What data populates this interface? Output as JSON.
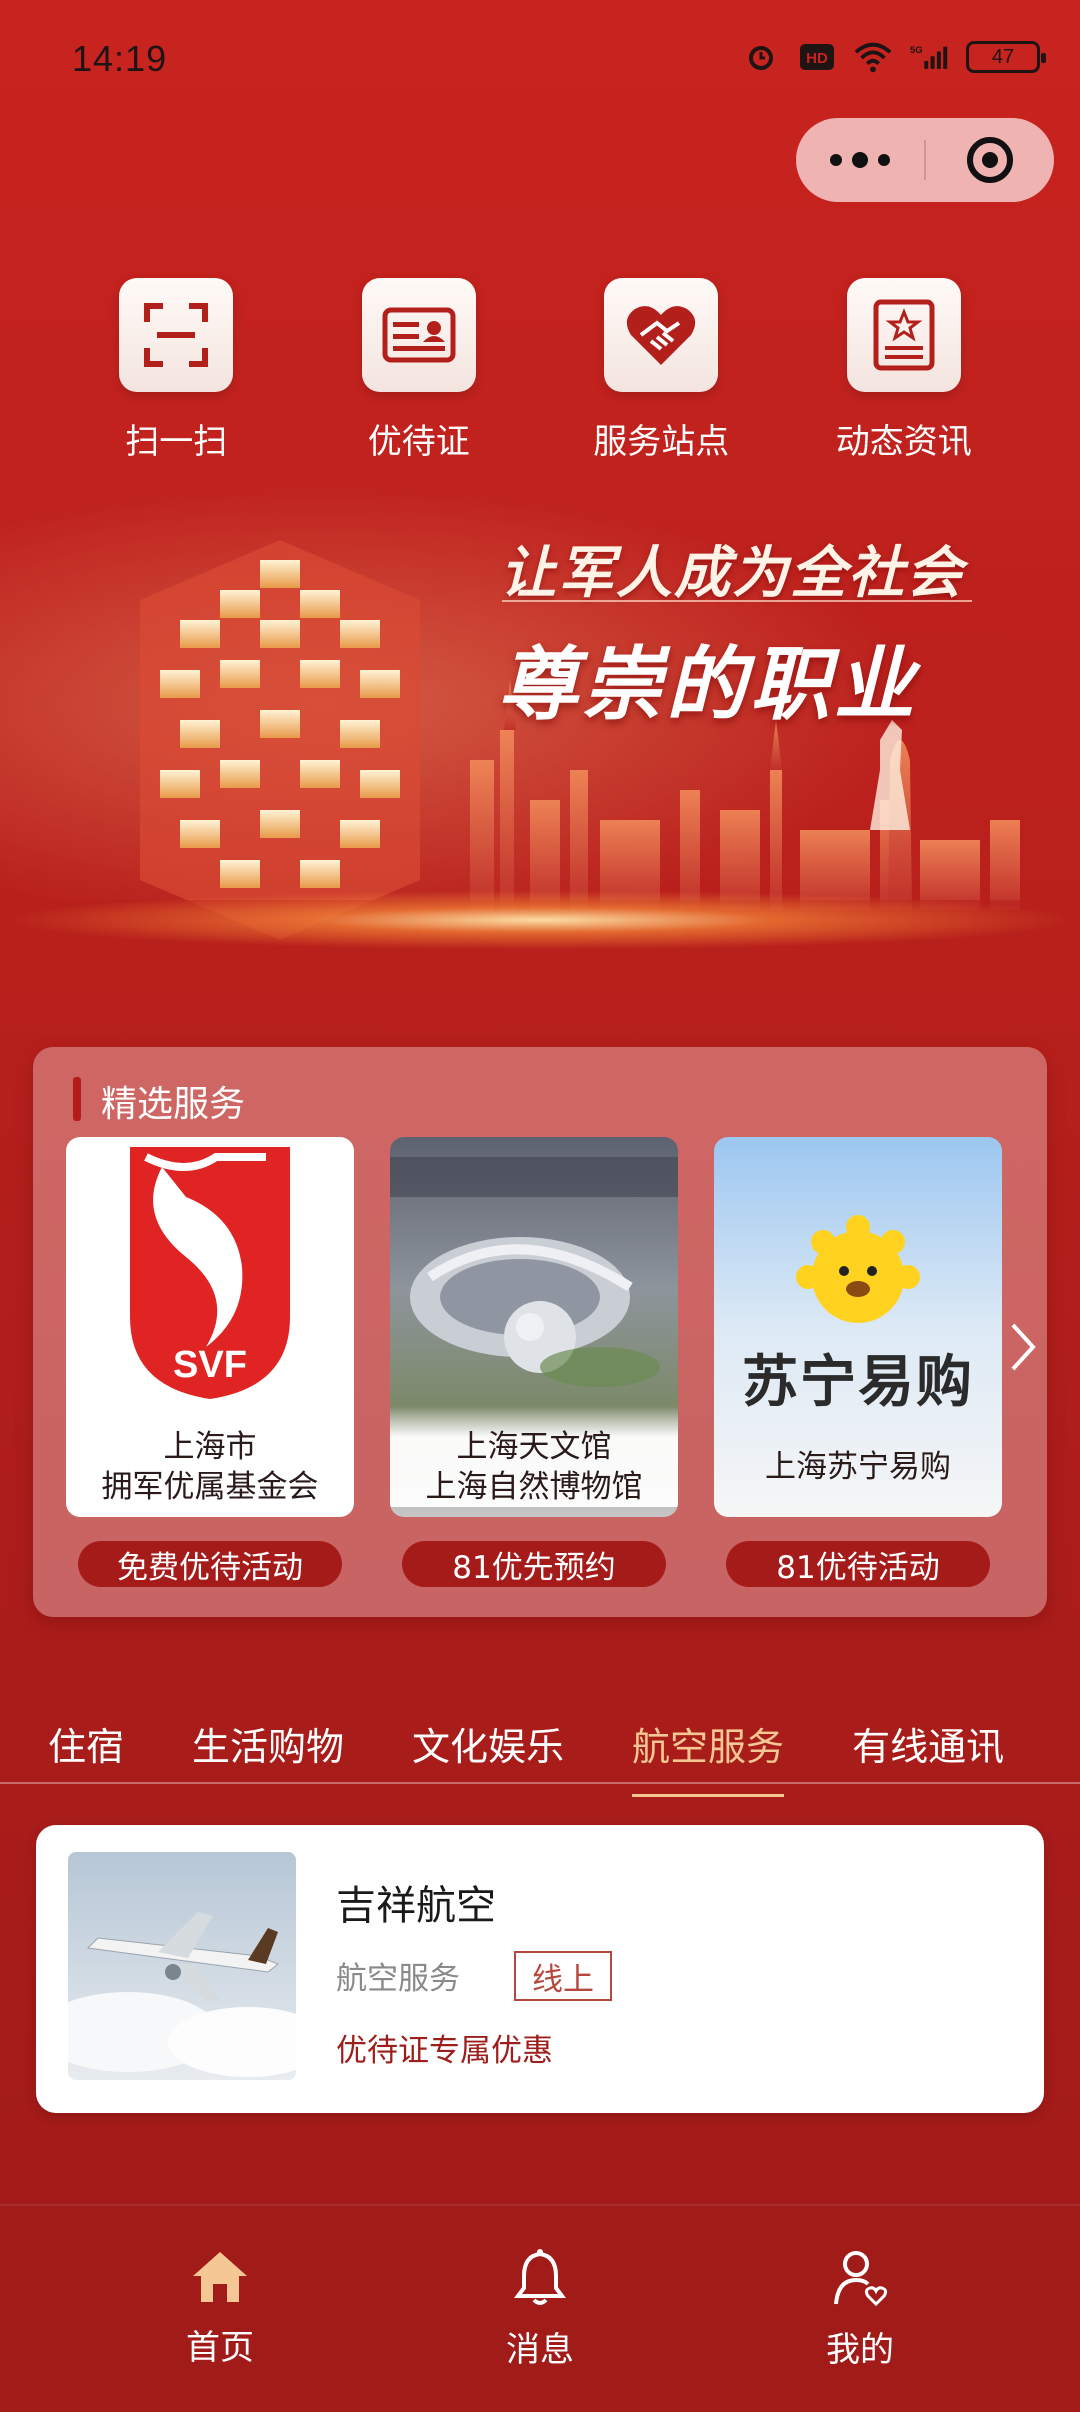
{
  "status_bar": {
    "time": "14:19",
    "battery": "47",
    "network": "5G"
  },
  "quick_actions": [
    {
      "label": "扫一扫",
      "icon": "scan-icon"
    },
    {
      "label": "优待证",
      "icon": "id-card-icon"
    },
    {
      "label": "服务站点",
      "icon": "handshake-heart-icon"
    },
    {
      "label": "动态资讯",
      "icon": "news-star-icon"
    }
  ],
  "banner": {
    "line1": "让军人成为全社会",
    "line2": "尊崇的职业"
  },
  "featured": {
    "title": "精选服务",
    "items": [
      {
        "name_line1": "上海市",
        "name_line2": "拥军优属基金会",
        "action": "免费优待活动",
        "logo_text": "SVF"
      },
      {
        "name_line1": "上海天文馆",
        "name_line2": "上海自然博物馆",
        "action": "81优先预约"
      },
      {
        "name_line1": "上海苏宁易购",
        "name_line2": "",
        "action": "81优待活动",
        "logo_text": "苏宁易购"
      }
    ]
  },
  "tabs": [
    "住宿",
    "生活购物",
    "文化娱乐",
    "航空服务",
    "有线通讯"
  ],
  "active_tab": "航空服务",
  "listing": {
    "name": "吉祥航空",
    "category": "航空服务",
    "tag": "线上",
    "benefit": "优待证专属优惠"
  },
  "bottom_nav": [
    {
      "label": "首页",
      "icon": "home-icon"
    },
    {
      "label": "消息",
      "icon": "bell-icon"
    },
    {
      "label": "我的",
      "icon": "user-heart-icon"
    }
  ],
  "colors": {
    "primary": "#b8201c",
    "accent": "#f4c794",
    "pill": "#a51b1a"
  }
}
